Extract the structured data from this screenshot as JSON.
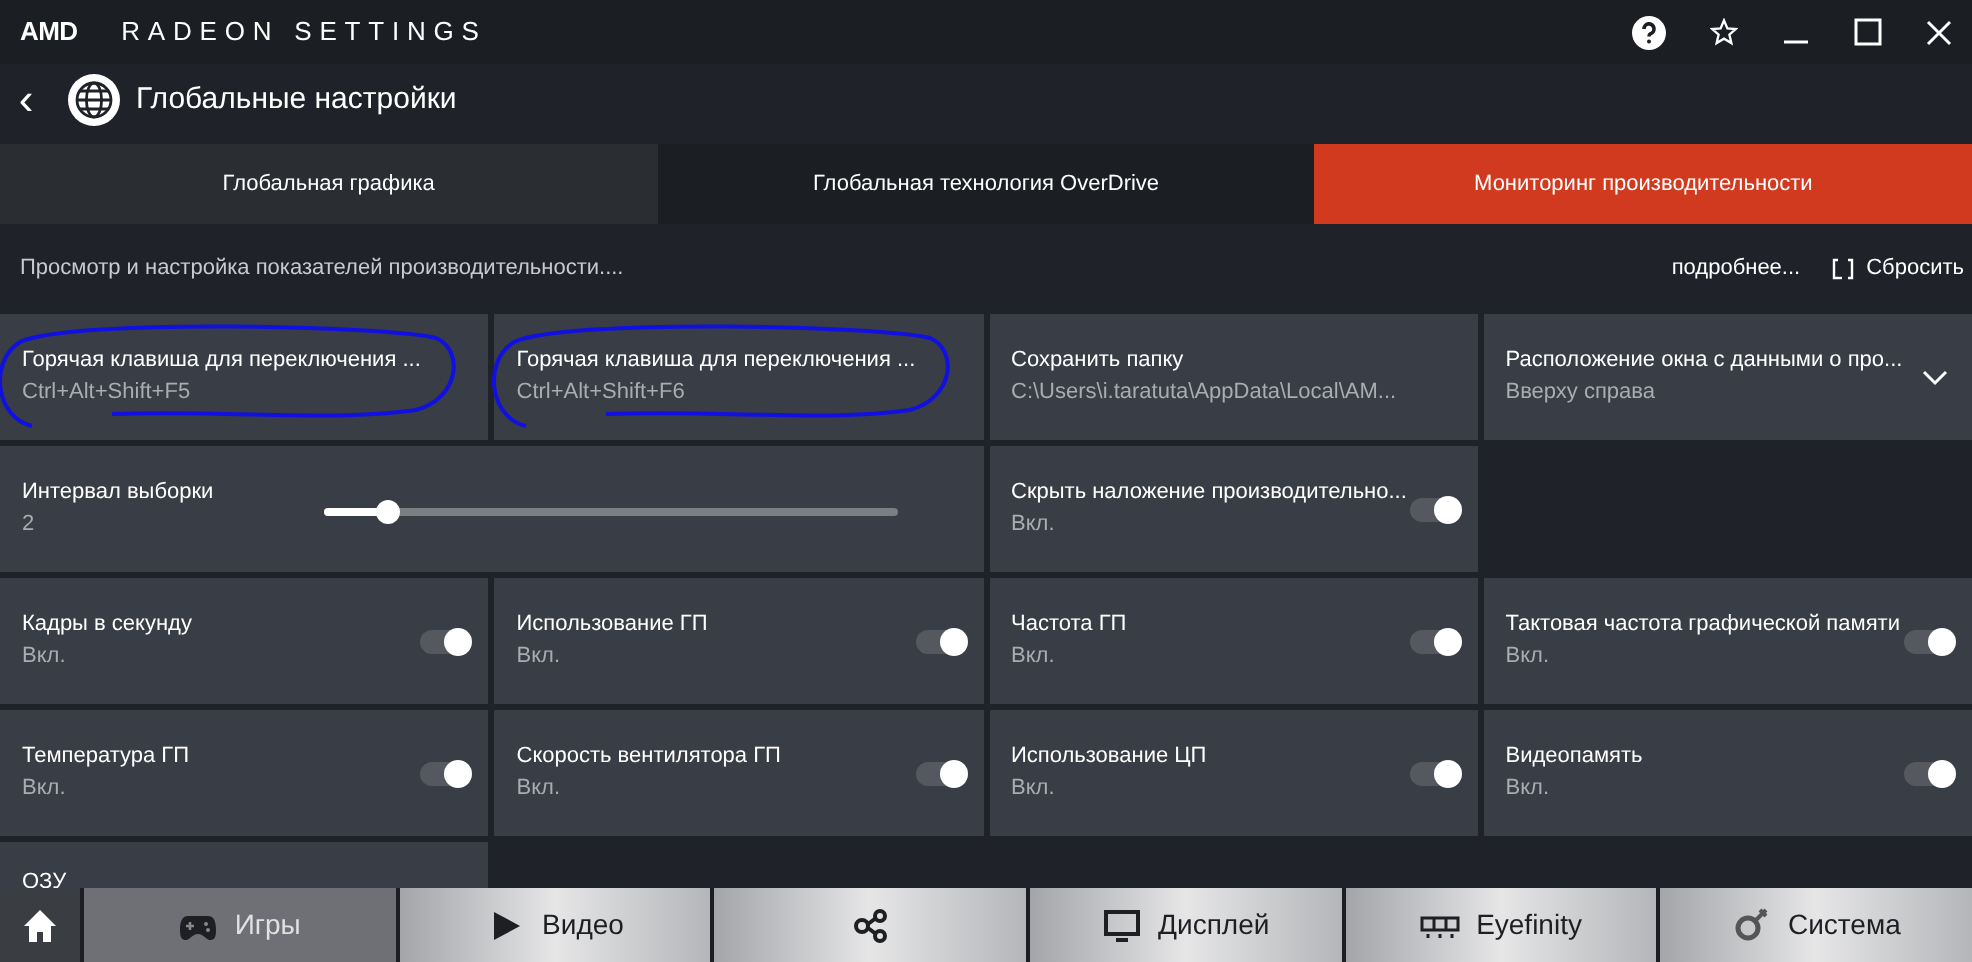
{
  "window": {
    "brand": "AMD",
    "title": "RADEON SETTINGS"
  },
  "header": {
    "back": "‹",
    "title": "Глобальные настройки"
  },
  "tabs": [
    {
      "label": "Глобальная графика",
      "selected": false
    },
    {
      "label": "Глобальная технология OverDrive",
      "selected": false
    },
    {
      "label": "Мониторинг производительности",
      "selected": true
    }
  ],
  "subheader": {
    "description": "Просмотр и настройка показателей производительности....",
    "more": "подробнее...",
    "reset": "Сбросить"
  },
  "tiles": [
    {
      "kind": "text",
      "label": "Горячая клавиша для переключения ...",
      "value": "Ctrl+Alt+Shift+F5",
      "circled": true
    },
    {
      "kind": "text",
      "label": "Горячая клавиша для переключения ...",
      "value": "Ctrl+Alt+Shift+F6",
      "circled": true
    },
    {
      "kind": "text",
      "label": "Сохранить папку",
      "value": "C:\\Users\\i.taratuta\\AppData\\Local\\AM...",
      "circled": false
    },
    {
      "kind": "dropdown",
      "label": "Расположение окна с данными о про...",
      "value": "Вверху справа",
      "circled": false
    },
    {
      "kind": "slider",
      "label": "Интервал выборки",
      "value": "2",
      "level": 0.11,
      "circled": false
    },
    {
      "kind": "toggle",
      "label": "Скрыть наложение производительно...",
      "value": "Вкл.",
      "on": true,
      "circled": false
    },
    {
      "kind": "empty"
    },
    {
      "kind": "toggle",
      "label": "Кадры в секунду",
      "value": "Вкл.",
      "on": true,
      "circled": false
    },
    {
      "kind": "toggle",
      "label": "Использование ГП",
      "value": "Вкл.",
      "on": true,
      "circled": false
    },
    {
      "kind": "toggle",
      "label": "Частота ГП",
      "value": "Вкл.",
      "on": true,
      "circled": false
    },
    {
      "kind": "toggle",
      "label": "Тактовая частота графической памяти",
      "value": "Вкл.",
      "on": true,
      "circled": false
    },
    {
      "kind": "toggle",
      "label": "Температура ГП",
      "value": "Вкл.",
      "on": true,
      "circled": false
    },
    {
      "kind": "toggle",
      "label": "Скорость вентилятора ГП",
      "value": "Вкл.",
      "on": true,
      "circled": false
    },
    {
      "kind": "toggle",
      "label": "Использование ЦП",
      "value": "Вкл.",
      "on": true,
      "circled": false
    },
    {
      "kind": "toggle",
      "label": "Видеопамять",
      "value": "Вкл.",
      "on": true,
      "circled": false
    },
    {
      "kind": "partial",
      "label": "ОЗУ",
      "circled": false
    }
  ],
  "nav": [
    {
      "kind": "home",
      "selected": false
    },
    {
      "kind": "games",
      "label": "Игры",
      "selected": true
    },
    {
      "kind": "video",
      "label": "Видео",
      "selected": false
    },
    {
      "kind": "connect",
      "selected": false
    },
    {
      "kind": "display",
      "label": "Дисплей",
      "selected": false
    },
    {
      "kind": "eyefinity",
      "label": "Eyefinity",
      "selected": false
    },
    {
      "kind": "system",
      "label": "Система",
      "selected": false
    }
  ]
}
